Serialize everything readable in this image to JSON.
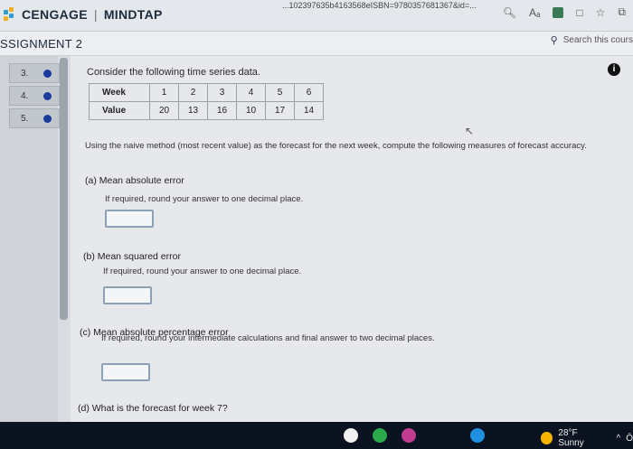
{
  "browser": {
    "url_text": "...102397635b4163568eISBN=9780357681367&id=...",
    "brand_left": "CENGAGE",
    "brand_right": "MINDTAP",
    "icons": [
      "zoom-icon",
      "read-aloud-icon",
      "extension-icon",
      "sidebar-icon",
      "favorites-icon",
      "collections-icon"
    ]
  },
  "assignment": {
    "title": "SSIGNMENT 2",
    "search_placeholder": "Search this cours"
  },
  "sidebar": {
    "questions": [
      {
        "number": "3."
      },
      {
        "number": "4."
      },
      {
        "number": "5."
      }
    ],
    "dot_color": "#1a3a9c"
  },
  "question": {
    "intro": "Consider the following time series data.",
    "info_symbol": "i",
    "table": {
      "row_week_label": "Week",
      "row_value_label": "Value",
      "weeks": [
        "1",
        "2",
        "3",
        "4",
        "5",
        "6"
      ],
      "values": [
        "20",
        "13",
        "16",
        "10",
        "17",
        "14"
      ]
    },
    "description": "Using the naive method (most recent value) as the forecast for the next week, compute the following measures of forecast accuracy.",
    "parts": [
      {
        "label": "(a) Mean absolute error",
        "instruction": "If required, round your answer to one decimal place."
      },
      {
        "label": "(b) Mean squared error",
        "instruction": "If required, round your answer to one decimal place."
      },
      {
        "label": "(c) Mean absolute percentage error",
        "instruction": "If required, round your intermediate calculations and final answer to two decimal places."
      },
      {
        "label": "(d) What is the forecast for week 7?",
        "instruction": ""
      }
    ]
  },
  "taskbar": {
    "weather": "28°F Sunny",
    "caret": "^",
    "corner": "Ō"
  }
}
